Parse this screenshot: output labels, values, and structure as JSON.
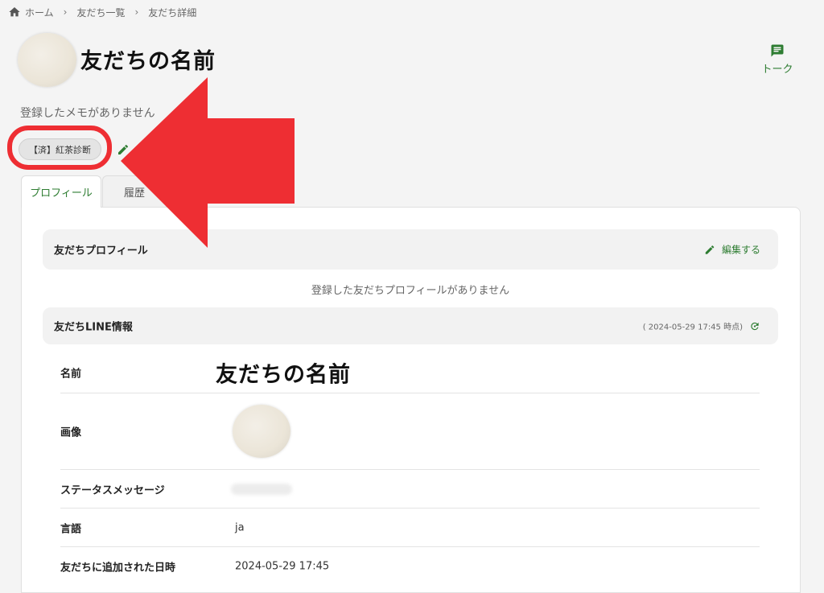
{
  "breadcrumb": {
    "items": [
      "ホーム",
      "友だち一覧",
      "友だち詳細"
    ]
  },
  "header": {
    "friend_name": "友だちの名前",
    "talk_label": "トーク"
  },
  "memo": {
    "text": "登録したメモがありません"
  },
  "tags": [
    {
      "label": "【済】紅茶診断"
    }
  ],
  "tabs": [
    {
      "label": "プロフィール",
      "active": true
    },
    {
      "label": "履歴",
      "active": false
    }
  ],
  "profile_section": {
    "title": "友だちプロフィール",
    "edit_label": "編集する",
    "empty_text": "登録した友だちプロフィールがありません"
  },
  "line_section": {
    "title": "友だちLINE情報",
    "timestamp": "( 2024-05-29 17:45 時点)",
    "rows": [
      {
        "label": "名前",
        "value": "友だちの名前"
      },
      {
        "label": "画像",
        "value": ""
      },
      {
        "label": "ステータスメッセージ",
        "value": ""
      },
      {
        "label": "言語",
        "value": "ja"
      },
      {
        "label": "友だちに追加された日時",
        "value": "2024-05-29 17:45"
      }
    ]
  },
  "colors": {
    "accent": "#2e7d32",
    "annotation": "#ee2e33",
    "background": "#f4f4f4"
  }
}
